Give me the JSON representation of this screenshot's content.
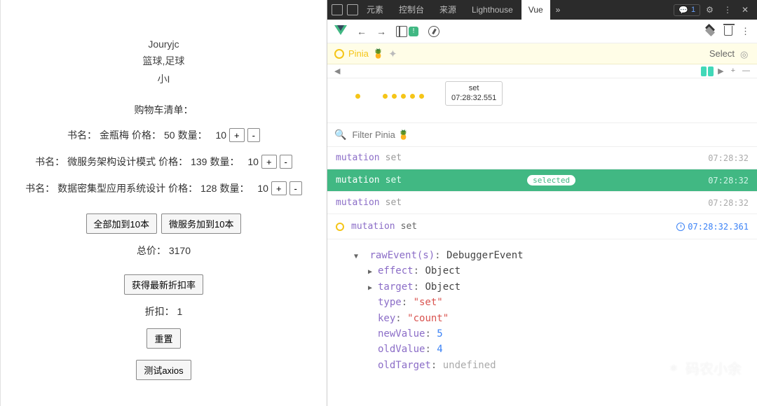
{
  "leftPane": {
    "username": "Jouryjc",
    "hobbies": "篮球,足球",
    "nickname": "小I",
    "cartTitle": "购物车清单：",
    "labels": {
      "bookName": "书名：",
      "price": "价格：",
      "qty": "数量：",
      "inc": "+",
      "dec": "-"
    },
    "books": [
      {
        "name": "金瓶梅",
        "price": 50,
        "qty": 10
      },
      {
        "name": "微服务架构设计模式",
        "price": 139,
        "qty": 10
      },
      {
        "name": "数据密集型应用系统设计",
        "price": 128,
        "qty": 10
      }
    ],
    "allTo10": "全部加到10本",
    "msTo10": "微服务加到10本",
    "totalLabel": "总价：",
    "totalValue": 3170,
    "getDiscount": "获得最新折扣率",
    "discountLabel": "折扣：",
    "discountValue": 1,
    "reset": "重置",
    "testAxios": "测试axios"
  },
  "devtools": {
    "tabs": {
      "elements": "元素",
      "console": "控制台",
      "sources": "来源",
      "lighthouse": "Lighthouse",
      "vue": "Vue"
    },
    "msgCount": 1,
    "pinia": {
      "label": "Pinia",
      "emoji": "🍍",
      "select": "Select"
    },
    "timeline": {
      "tooltipLabel": "set",
      "tooltipTime": "07:28:32.551",
      "plus": "+",
      "minus": "—"
    },
    "filterPlaceholder": "Filter Pinia 🍍",
    "mutations": [
      {
        "kind": "mutation",
        "op": "set",
        "time": "07:28:32"
      },
      {
        "kind": "mutation",
        "op": "set",
        "time": "07:28:32",
        "selected": true
      },
      {
        "kind": "mutation",
        "op": "set",
        "time": "07:28:32"
      }
    ],
    "current": {
      "kind": "mutation",
      "op": "set",
      "time": "07:28:32.361"
    },
    "detail": {
      "header": {
        "key": "rawEvent(s)",
        "type": "DebuggerEvent"
      },
      "rows": [
        {
          "key": "effect",
          "val": "Object",
          "kind": "type",
          "expandable": true
        },
        {
          "key": "target",
          "val": "Object",
          "kind": "type",
          "expandable": true
        },
        {
          "key": "type",
          "val": "\"set\"",
          "kind": "str"
        },
        {
          "key": "key",
          "val": "\"count\"",
          "kind": "str"
        },
        {
          "key": "newValue",
          "val": "5",
          "kind": "num"
        },
        {
          "key": "oldValue",
          "val": "4",
          "kind": "num"
        },
        {
          "key": "oldTarget",
          "val": "undefined",
          "kind": "undef"
        }
      ]
    },
    "selectedBadge": "selected"
  },
  "watermark": "码农小余"
}
